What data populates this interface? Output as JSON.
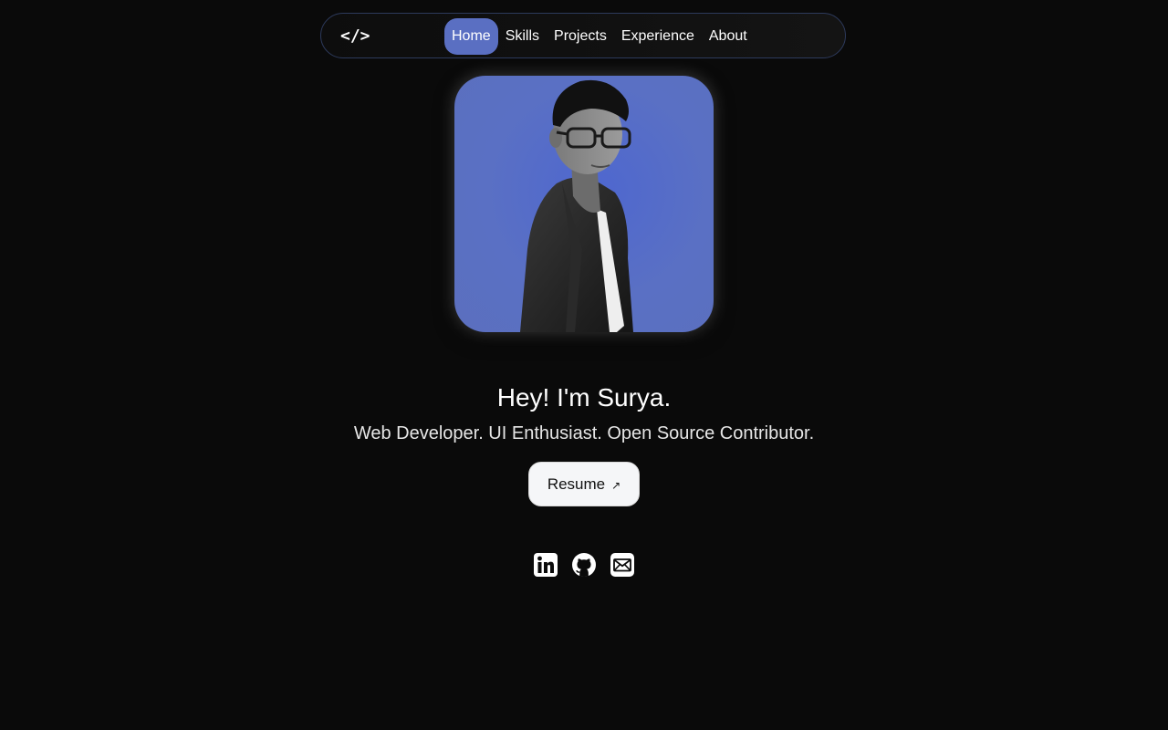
{
  "nav": {
    "logo": "</>",
    "items": [
      {
        "label": "Home",
        "active": true
      },
      {
        "label": "Skills",
        "active": false
      },
      {
        "label": "Projects",
        "active": false
      },
      {
        "label": "Experience",
        "active": false
      },
      {
        "label": "About",
        "active": false
      }
    ]
  },
  "hero": {
    "headline": "Hey! I'm Surya.",
    "tagline": "Web Developer. UI Enthusiast. Open Source Contributor.",
    "resume_label": "Resume",
    "resume_arrow": "↗"
  },
  "socials": [
    {
      "icon": "linkedin-icon"
    },
    {
      "icon": "github-icon"
    },
    {
      "icon": "mail-icon"
    }
  ],
  "colors": {
    "background": "#0a0a0a",
    "accent": "#5a6fc2",
    "avatar_bg": "#5b6fbe"
  }
}
